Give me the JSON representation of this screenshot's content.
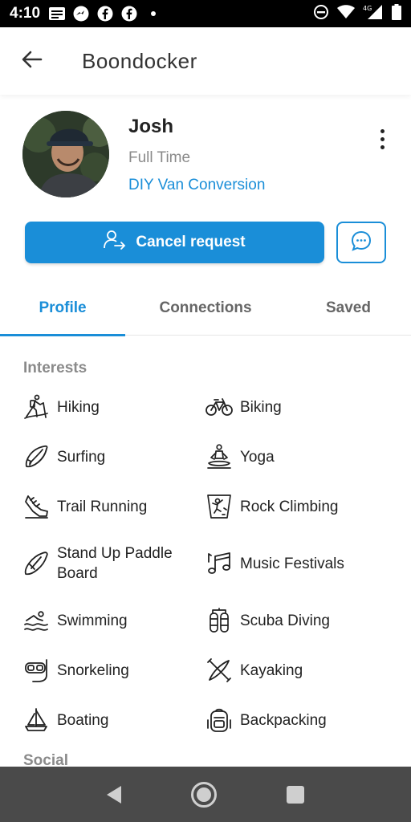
{
  "status_bar": {
    "time": "4:10"
  },
  "app_bar": {
    "title": "Boondocker"
  },
  "profile": {
    "name": "Josh",
    "status": "Full Time",
    "link": "DIY Van Conversion"
  },
  "actions": {
    "cancel_label": "Cancel request"
  },
  "tabs": [
    {
      "label": "Profile",
      "active": true
    },
    {
      "label": "Connections",
      "active": false
    },
    {
      "label": "Saved",
      "active": false
    }
  ],
  "interests": {
    "title": "Interests",
    "items": [
      {
        "label": "Hiking",
        "icon": "hiking-icon"
      },
      {
        "label": "Biking",
        "icon": "bike-icon"
      },
      {
        "label": "Surfing",
        "icon": "surfboard-icon"
      },
      {
        "label": "Yoga",
        "icon": "yoga-icon"
      },
      {
        "label": "Trail Running",
        "icon": "trail-running-icon"
      },
      {
        "label": "Rock Climbing",
        "icon": "rock-climbing-icon"
      },
      {
        "label": "Stand Up Paddle Board",
        "icon": "paddle-board-icon"
      },
      {
        "label": "Music Festivals",
        "icon": "music-notes-icon"
      },
      {
        "label": "Swimming",
        "icon": "swimming-icon"
      },
      {
        "label": "Scuba Diving",
        "icon": "scuba-tank-icon"
      },
      {
        "label": "Snorkeling",
        "icon": "snorkel-mask-icon"
      },
      {
        "label": "Kayaking",
        "icon": "kayak-icon"
      },
      {
        "label": "Boating",
        "icon": "sailboat-icon"
      },
      {
        "label": "Backpacking",
        "icon": "backpack-icon"
      }
    ]
  },
  "social": {
    "title": "Social"
  },
  "colors": {
    "accent": "#1a8ed8",
    "muted": "#8a8a8a",
    "nav_bar": "#4a4a4a"
  }
}
